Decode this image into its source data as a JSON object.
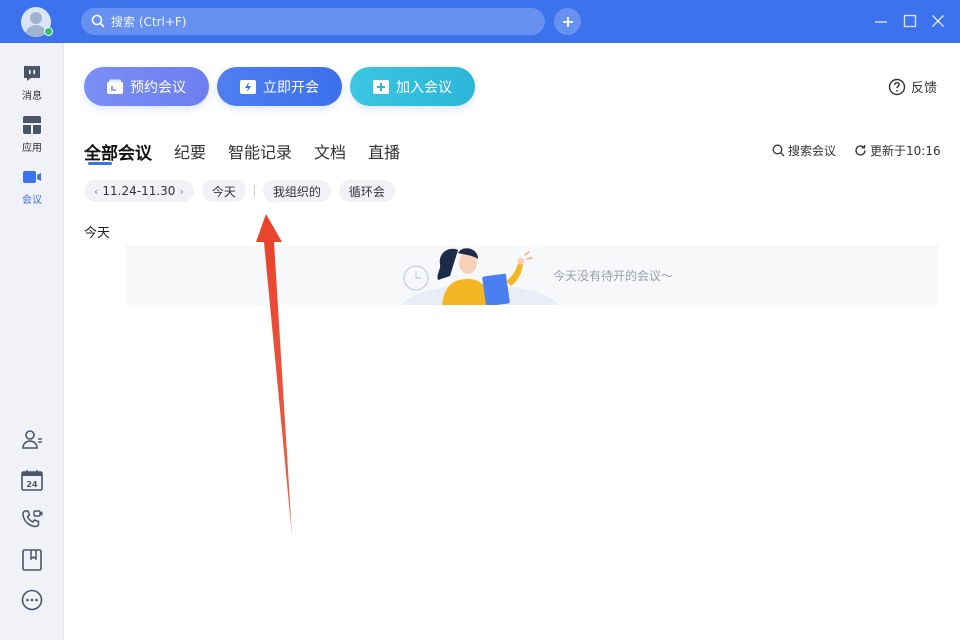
{
  "titlebar": {
    "search_placeholder": "搜索 (Ctrl+F)"
  },
  "rail": {
    "items": [
      {
        "label": "消息"
      },
      {
        "label": "应用"
      },
      {
        "label": "会议"
      }
    ]
  },
  "actions": {
    "schedule_label": "预约会议",
    "instant_label": "立即开会",
    "join_label": "加入会议",
    "feedback_label": "反馈"
  },
  "tabs": [
    "全部会议",
    "纪要",
    "智能记录",
    "文档",
    "直播"
  ],
  "tools": {
    "search_meeting": "搜索会议",
    "updated": "更新于10:16"
  },
  "filters": {
    "date_range": "11.24-11.30",
    "chips": [
      "今天",
      "我组织的",
      "循环会"
    ]
  },
  "section": {
    "today_label": "今天",
    "empty_text": "今天没有待开的会议～"
  },
  "colors": {
    "accent": "#3c72ec",
    "annotation_arrow": "#e8432a"
  }
}
